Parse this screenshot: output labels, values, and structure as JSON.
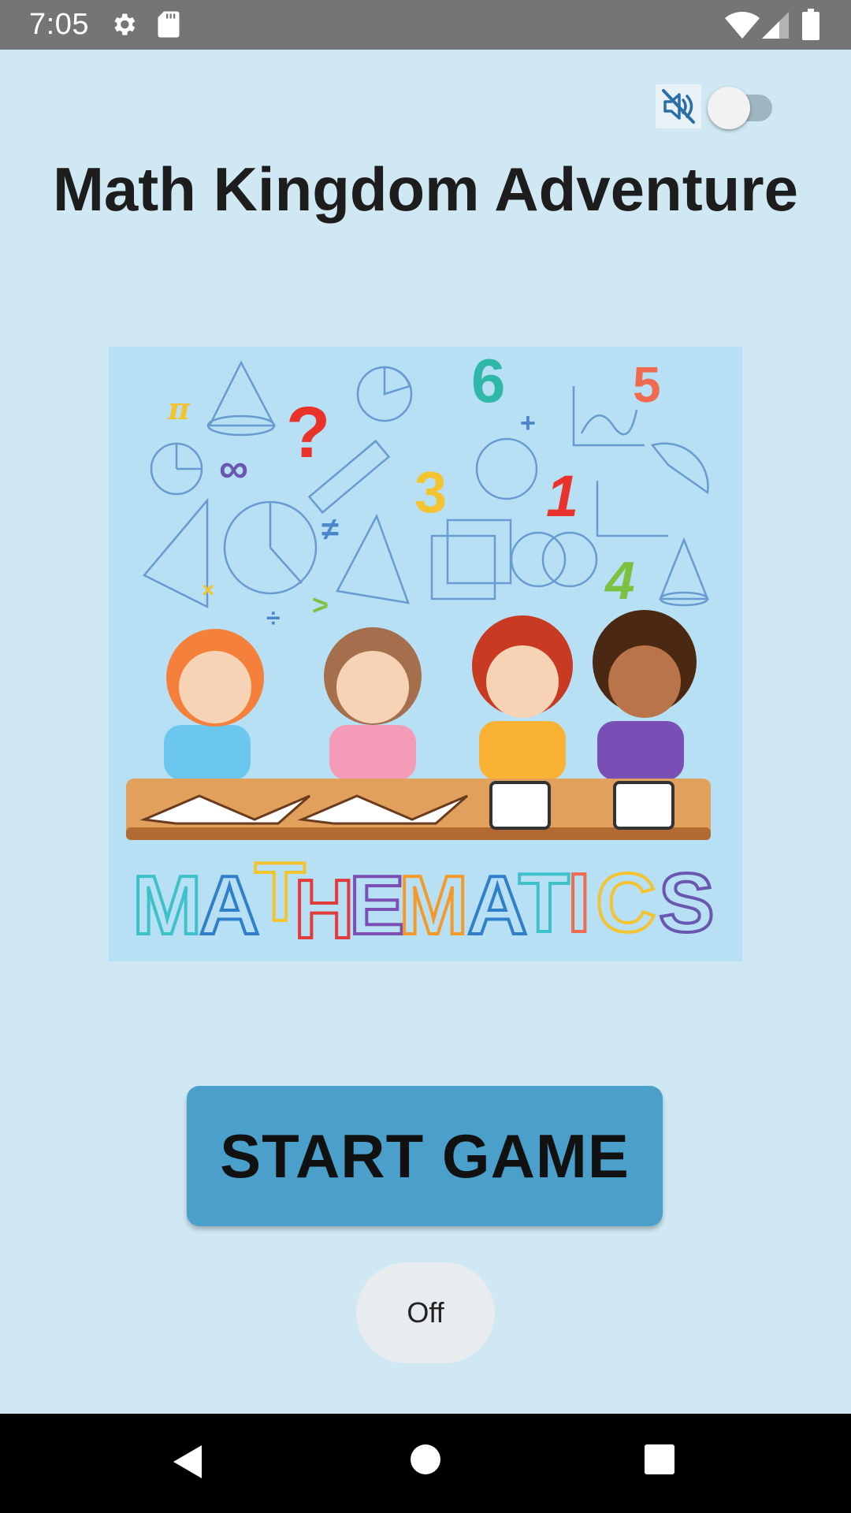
{
  "status_bar": {
    "time": "7:05",
    "icons": [
      "gear-icon",
      "sd-card-icon",
      "wifi-icon",
      "signal-icon",
      "battery-icon"
    ]
  },
  "sound": {
    "mute_icon": "speaker-muted-icon",
    "toggle_state": "off"
  },
  "title": "Math Kingdom Adventure",
  "illustration": {
    "banner_text": "MATHEMATICS",
    "banner_colors": [
      "#3fc1c9",
      "#2f80c8",
      "#f4c430",
      "#e23b3b",
      "#7b4fb3",
      "#f39a2b",
      "#2f80c8",
      "#3fc1c9",
      "#f06a4f",
      "#f4c430",
      "#6a58b0"
    ],
    "floating_numbers": [
      "6",
      "3",
      "1",
      "5",
      "4",
      "π",
      "?"
    ]
  },
  "start_button": {
    "label": "START GAME"
  },
  "off_button": {
    "label": "Off"
  },
  "nav_bar": {
    "buttons": [
      "back-icon",
      "home-icon",
      "recents-icon"
    ]
  },
  "colors": {
    "background": "#cfe8f3",
    "status_bar": "#757575",
    "button": "#4aa0cb",
    "illustration_bg": "#b7e0f5"
  }
}
